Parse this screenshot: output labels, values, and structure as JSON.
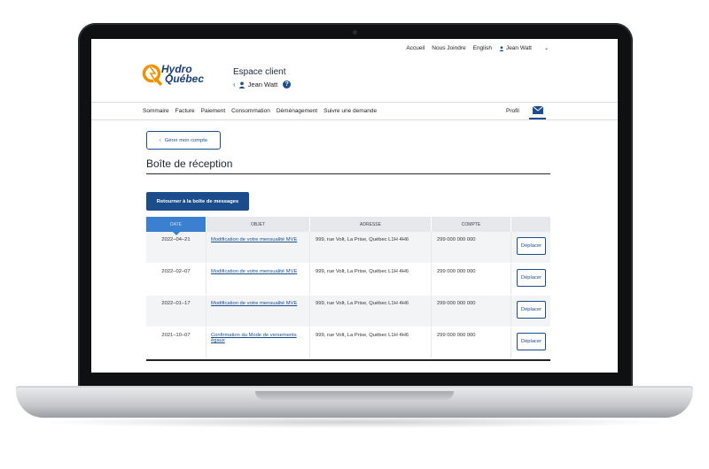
{
  "topnav": {
    "accueil": "Accueil",
    "joindre": "Nous Joindre",
    "english": "English",
    "user": "Jean Watt"
  },
  "logo": {
    "line1": "Hydro",
    "line2": "Québec"
  },
  "header": {
    "title": "Espace client",
    "user": "Jean Watt"
  },
  "mainnav": {
    "items": [
      "Sommaire",
      "Facture",
      "Paiement",
      "Consommation",
      "Déménagement",
      "Suivre une demande"
    ],
    "profil": "Profil"
  },
  "manage_account": "Gérer mon compte",
  "page_title": "Boîte de réception",
  "back_button": "Retourner à la boîte de messages",
  "table": {
    "headers": [
      "DATE",
      "OBJET",
      "ADRESSE",
      "COMPTE"
    ],
    "rows": [
      {
        "date": "2022–04–21",
        "subject": "Modification de votre mensualité MVE",
        "address": "999, rue Volt, La Prise, Québec  L1H 4H6",
        "account": "299 000 000 000",
        "action": "Déplacer"
      },
      {
        "date": "2022–02–07",
        "subject": "Modification de votre mensualité MVE",
        "address": "999, rue Volt, La Prise, Québec  L1H 4H6",
        "account": "299 000 000 000",
        "action": "Déplacer"
      },
      {
        "date": "2022–01–17",
        "subject": "Modification de votre mensualité MVE",
        "address": "999, rue Volt, La Prise, Québec  L1H 4H6",
        "account": "299 000 000 000",
        "action": "Déplacer"
      },
      {
        "date": "2021–10–07",
        "subject": "Confirmation du Mode de versements égaux",
        "address": "999, rue Volt, La Prise, Québec  L1H 4H6",
        "account": "299 000 000 000",
        "action": "Déplacer"
      }
    ]
  },
  "colors": {
    "brand_blue": "#1b4d8c",
    "sorted_header": "#3a7fd0",
    "logo_orange": "#f29100"
  }
}
